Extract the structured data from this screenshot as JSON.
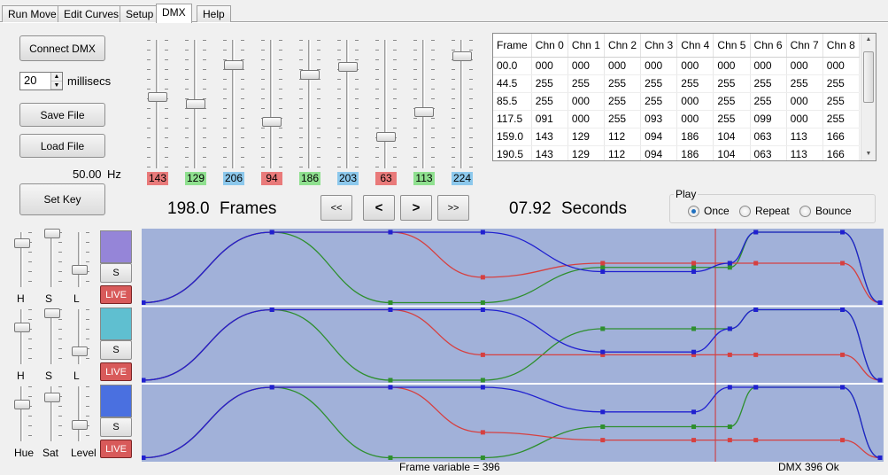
{
  "tabs": [
    {
      "label": "Run Move",
      "active": false
    },
    {
      "label": "Edit Curves",
      "active": false
    },
    {
      "label": "Setup",
      "active": false
    },
    {
      "label": "DMX",
      "active": true
    },
    {
      "label": "Help",
      "active": false
    }
  ],
  "controls": {
    "connect_label": "Connect DMX",
    "millisecs_value": "20",
    "millisecs_label": "millisecs",
    "save_label": "Save File",
    "load_label": "Load File",
    "hz_value": "50.00",
    "hz_unit": "Hz",
    "setkey_label": "Set Key"
  },
  "channels": [
    {
      "value": 143,
      "label": "143",
      "color": "#e97a7a"
    },
    {
      "value": 129,
      "label": "129",
      "color": "#8fe08f"
    },
    {
      "value": 206,
      "label": "206",
      "color": "#8cc8ec"
    },
    {
      "value": 94,
      "label": "94",
      "color": "#e97a7a"
    },
    {
      "value": 186,
      "label": "186",
      "color": "#8fe08f"
    },
    {
      "value": 203,
      "label": "203",
      "color": "#8cc8ec"
    },
    {
      "value": 63,
      "label": "63",
      "color": "#e97a7a"
    },
    {
      "value": 113,
      "label": "113",
      "color": "#8fe08f"
    },
    {
      "value": 224,
      "label": "224",
      "color": "#8cc8ec"
    }
  ],
  "table": {
    "headers": [
      "Frame",
      "Chn 0",
      "Chn 1",
      "Chn 2",
      "Chn 3",
      "Chn 4",
      "Chn 5",
      "Chn 6",
      "Chn 7",
      "Chn 8"
    ],
    "rows": [
      [
        "00.0",
        "000",
        "000",
        "000",
        "000",
        "000",
        "000",
        "000",
        "000",
        "000"
      ],
      [
        "44.5",
        "255",
        "255",
        "255",
        "255",
        "255",
        "255",
        "255",
        "255",
        "255"
      ],
      [
        "85.5",
        "255",
        "000",
        "255",
        "255",
        "000",
        "255",
        "255",
        "000",
        "255"
      ],
      [
        "117.5",
        "091",
        "000",
        "255",
        "093",
        "000",
        "255",
        "099",
        "000",
        "255"
      ],
      [
        "159.0",
        "143",
        "129",
        "112",
        "094",
        "186",
        "104",
        "063",
        "113",
        "166"
      ],
      [
        "190.5",
        "143",
        "129",
        "112",
        "094",
        "186",
        "104",
        "063",
        "113",
        "166"
      ]
    ]
  },
  "transport": {
    "frames_value": "198.0",
    "frames_label": "Frames",
    "first_label": "<<",
    "prev_label": "<",
    "next_label": ">",
    "last_label": ">>",
    "seconds_value": "07.92",
    "seconds_label": "Seconds"
  },
  "play": {
    "title": "Play",
    "options": [
      {
        "label": "Once",
        "selected": true
      },
      {
        "label": "Repeat",
        "selected": false
      },
      {
        "label": "Bounce",
        "selected": false
      }
    ]
  },
  "color_groups": [
    {
      "swatch": "#9585d8",
      "slider_labels": [
        "H",
        "S",
        "L"
      ],
      "levels": [
        0.81,
        0.98,
        0.33
      ],
      "s_label": "S",
      "live_label": "LIVE"
    },
    {
      "swatch": "#5fbfd0",
      "slider_labels": [
        "H",
        "S",
        "L"
      ],
      "levels": [
        0.67,
        0.93,
        0.24
      ],
      "s_label": "S",
      "live_label": "LIVE"
    },
    {
      "swatch": "#4a70e0",
      "slider_labels": [
        "Hue",
        "Sat",
        "Level"
      ],
      "levels": [
        0.67,
        0.8,
        0.3
      ],
      "s_label": "S",
      "live_label": "LIVE"
    }
  ],
  "curves": {
    "background": "#a1b1d9",
    "playhead_frame": 198,
    "total_frames": 255,
    "line_colors": {
      "red": "#d64040",
      "green": "#2e8f2e",
      "blue": "#2020d0"
    },
    "keyframes": [
      0,
      44.5,
      85.5,
      117.5,
      159,
      190.5,
      203,
      212,
      242,
      255
    ],
    "lanes": [
      {
        "red": [
          0,
          1.0,
          1.0,
          0.36,
          0.56,
          0.56,
          0.56,
          0.56,
          0.56,
          0
        ],
        "green": [
          0,
          1.0,
          0.0,
          0.0,
          0.5,
          0.5,
          0.5,
          1.0,
          1.0,
          0
        ],
        "blue": [
          0,
          1.0,
          1.0,
          1.0,
          0.44,
          0.44,
          0.56,
          1.0,
          1.0,
          0
        ]
      },
      {
        "red": [
          0,
          1.0,
          1.0,
          0.36,
          0.36,
          0.36,
          0.36,
          0.36,
          0.36,
          0
        ],
        "green": [
          0,
          1.0,
          0.0,
          0.0,
          0.73,
          0.73,
          0.73,
          1.0,
          1.0,
          0
        ],
        "blue": [
          0,
          1.0,
          1.0,
          1.0,
          0.4,
          0.4,
          0.73,
          1.0,
          1.0,
          0
        ]
      },
      {
        "red": [
          0,
          1.0,
          1.0,
          0.36,
          0.25,
          0.25,
          0.25,
          0.25,
          0.25,
          0
        ],
        "green": [
          0,
          1.0,
          0.0,
          0.0,
          0.44,
          0.44,
          0.44,
          1.0,
          1.0,
          0
        ],
        "blue": [
          0,
          1.0,
          1.0,
          1.0,
          0.65,
          0.65,
          1.0,
          1.0,
          1.0,
          0
        ]
      }
    ]
  },
  "footer": {
    "frame_variable": "Frame variable = 396",
    "dmx_status": "DMX 396 Ok"
  }
}
